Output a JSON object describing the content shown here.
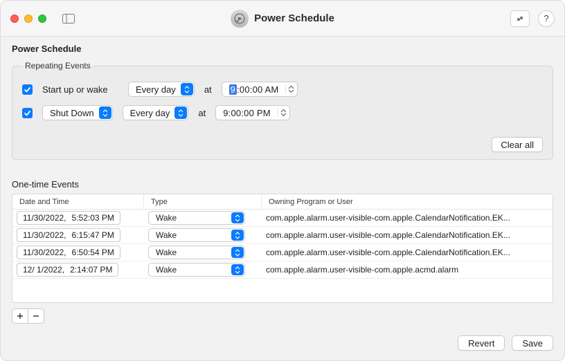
{
  "header": {
    "title": "Power Schedule"
  },
  "pane": {
    "title": "Power Schedule"
  },
  "repeating": {
    "legend": "Repeating Events",
    "at_label": "at",
    "startup": {
      "label": "Start up or wake",
      "frequency": "Every day",
      "time_hour_selected": "9",
      "time_rest": ":00:00 AM"
    },
    "shutdown": {
      "action": "Shut Down",
      "frequency": "Every day",
      "time": "9:00:00 PM"
    },
    "clear_all": "Clear all"
  },
  "onetime": {
    "heading": "One-time Events",
    "columns": {
      "datetime": "Date and Time",
      "type": "Type",
      "owner": "Owning Program or User"
    },
    "rows": [
      {
        "date": "11/30/2022,",
        "time": "5:52:03 PM",
        "type": "Wake",
        "owner": "com.apple.alarm.user-visible-com.apple.CalendarNotification.EK..."
      },
      {
        "date": "11/30/2022,",
        "time": "6:15:47 PM",
        "type": "Wake",
        "owner": "com.apple.alarm.user-visible-com.apple.CalendarNotification.EK..."
      },
      {
        "date": "11/30/2022,",
        "time": "6:50:54 PM",
        "type": "Wake",
        "owner": "com.apple.alarm.user-visible-com.apple.CalendarNotification.EK..."
      },
      {
        "date": "12/  1/2022,",
        "time": "2:14:07 PM",
        "type": "Wake",
        "owner": "com.apple.alarm.user-visible-com.apple.acmd.alarm"
      }
    ]
  },
  "footer": {
    "revert": "Revert",
    "save": "Save"
  }
}
